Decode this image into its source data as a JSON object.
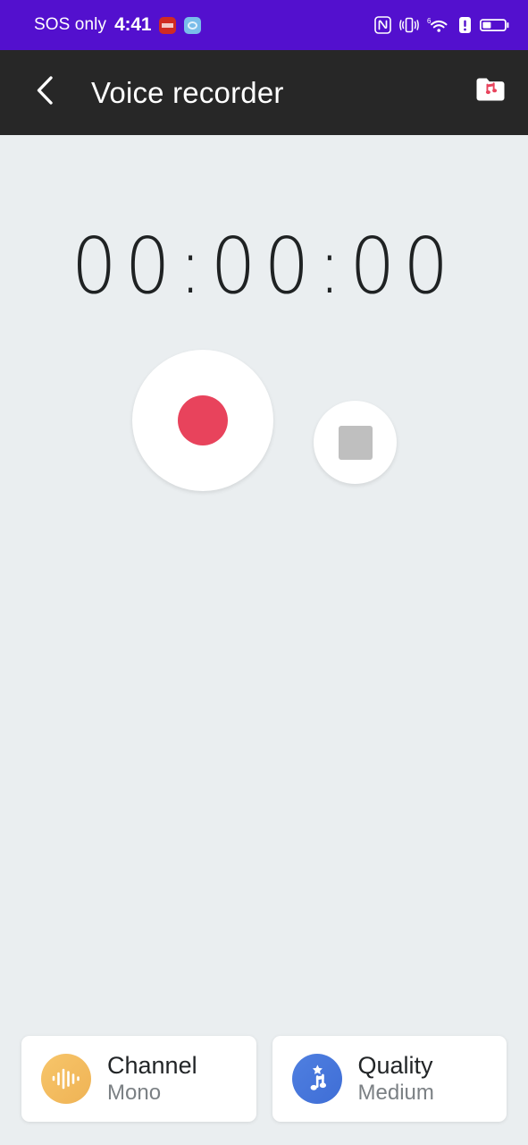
{
  "status_bar": {
    "carrier": "SOS only",
    "time": "4:41",
    "notification_icons": [
      "red-app-icon",
      "blue-app-icon"
    ],
    "right_icons": [
      "nfc-icon",
      "vibrate-icon",
      "wifi-6-icon",
      "alert-icon",
      "battery-icon"
    ],
    "background_color": "#5310CE",
    "text_color": "#FFFFFF"
  },
  "app_bar": {
    "back_icon": "chevron-left-icon",
    "title": "Voice recorder",
    "folder_icon": "music-folder-icon",
    "background_color": "#272727"
  },
  "recorder": {
    "timer": "00:00:00",
    "record_button_icon": "record-dot-icon",
    "record_color": "#E8435C",
    "stop_button_icon": "stop-square-icon",
    "stop_color": "#BFBFBF"
  },
  "options": [
    {
      "icon": "waveform-icon",
      "title": "Channel",
      "value": "Mono",
      "icon_color": "#EFB355"
    },
    {
      "icon": "music-star-icon",
      "title": "Quality",
      "value": "Medium",
      "icon_color": "#3F6ED6"
    }
  ],
  "theme": {
    "background_color": "#EAEEF0"
  }
}
